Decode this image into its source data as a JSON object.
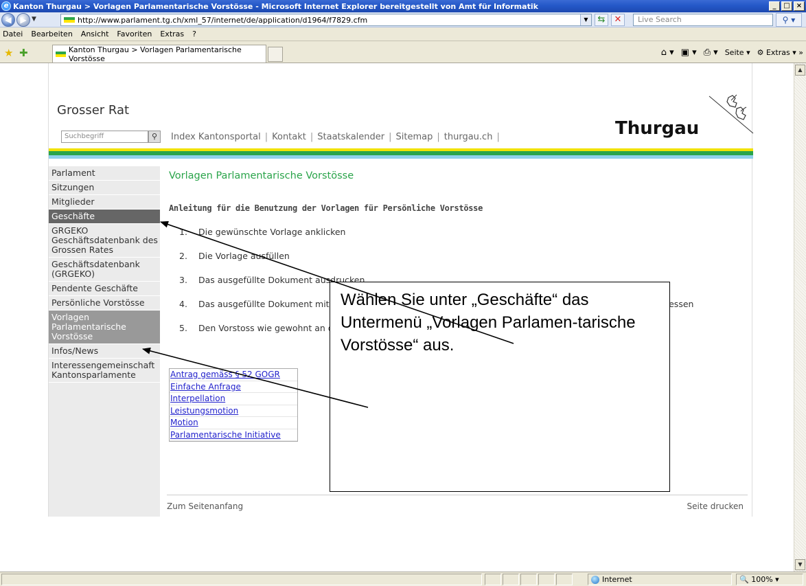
{
  "window": {
    "title": "Kanton Thurgau > Vorlagen Parlamentarische Vorstösse - Microsoft Internet Explorer bereitgestellt von Amt für Informatik",
    "buttons": [
      "_",
      "□",
      "×"
    ]
  },
  "address": {
    "url": "http://www.parlament.tg.ch/xml_57/internet/de/application/d1964/f7829.cfm",
    "search_placeholder": "Live Search"
  },
  "menu": [
    "Datei",
    "Bearbeiten",
    "Ansicht",
    "Favoriten",
    "Extras",
    "?"
  ],
  "tab": {
    "title": "Kanton Thurgau > Vorlagen Parlamentarische Vorstösse"
  },
  "commandbar": {
    "page": "Seite",
    "tools": "Extras"
  },
  "site": {
    "title": "Grosser Rat",
    "search_placeholder": "Suchbegriff",
    "toplinks": [
      "Index Kantonsportal",
      "Kontakt",
      "Staatskalender",
      "Sitemap",
      "thurgau.ch"
    ],
    "logo": "Thurgau"
  },
  "leftnav": [
    {
      "label": "Parlament",
      "state": "normal"
    },
    {
      "label": "Sitzungen",
      "state": "normal"
    },
    {
      "label": "Mitglieder",
      "state": "normal"
    },
    {
      "label": "Geschäfte",
      "state": "active"
    },
    {
      "label": "GRGEKO Geschäftsdatenbank des Grossen Rates",
      "state": "normal"
    },
    {
      "label": "Geschäftsdatenbank (GRGEKO)",
      "state": "normal"
    },
    {
      "label": "Pendente Geschäfte",
      "state": "normal"
    },
    {
      "label": "Persönliche Vorstösse",
      "state": "normal"
    },
    {
      "label": "Vorlagen Parlamentarische Vorstösse",
      "state": "selected"
    },
    {
      "label": "Infos/News",
      "state": "normal"
    },
    {
      "label": "Interessengemeinschaft Kantonsparlamente",
      "state": "normal"
    }
  ],
  "content": {
    "title": "Vorlagen Parlamentarische Vorstösse",
    "intro": "Anleitung für die Benutzung der Vorlagen für Persönliche Vorstösse",
    "steps": [
      {
        "num": "1.",
        "text": "Die gewünschte Vorlage anklicken"
      },
      {
        "num": "2.",
        "text": "Die Vorlage ausfüllen"
      },
      {
        "num": "3.",
        "text": "Das ausgefüllte Dokument ausdrucken"
      },
      {
        "num": "4.",
        "text": "Das ausgefüllte Dokument mit \"speichern unter\" in der eigenen Ablage ablegen (sofern gewünscht) und schliessen"
      },
      {
        "num": "5.",
        "text": "Den Vorstoss wie gewohnt an der Ratssitzung einbringen"
      }
    ],
    "links": [
      "Antrag gemäss § 52 GOGR",
      "Einfache Anfrage",
      "Interpellation",
      "Leistungsmotion",
      "Motion",
      "Parlamentarische Initiative"
    ],
    "footer_left": "Zum Seitenanfang",
    "footer_right": "Seite drucken"
  },
  "callout": {
    "text": "Wählen Sie unter „Geschäfte“ das Untermenü „Vorlagen Parlamen-tarische Vorstösse“ aus."
  },
  "status": {
    "zone": "Internet",
    "zoom": "100%"
  }
}
